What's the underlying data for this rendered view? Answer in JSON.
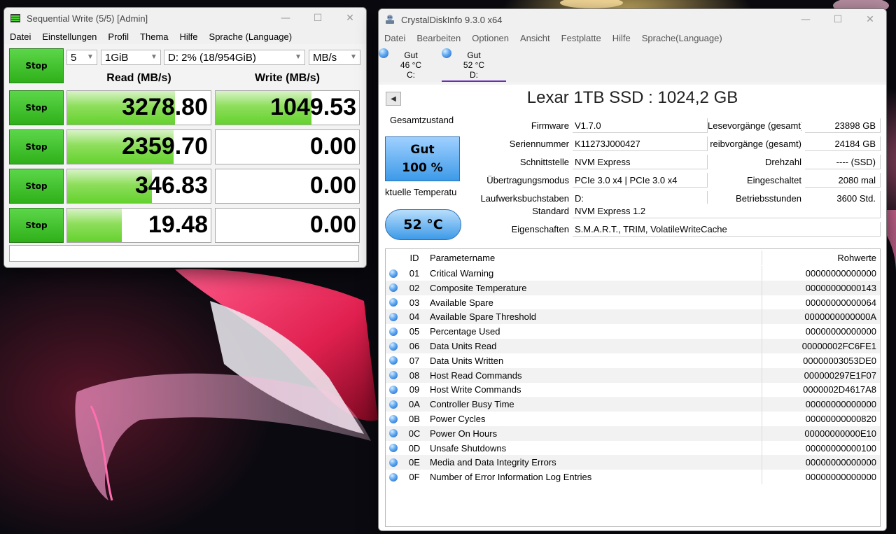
{
  "cdm": {
    "title": "Sequential Write (5/5) [Admin]",
    "menu": [
      "Datei",
      "Einstellungen",
      "Profil",
      "Thema",
      "Hilfe",
      "Sprache (Language)"
    ],
    "stop_label": "Stop",
    "count": "5",
    "size": "1GiB",
    "drive": "D: 2% (18/954GiB)",
    "unit": "MB/s",
    "read_header": "Read (MB/s)",
    "write_header": "Write (MB/s)",
    "rows": [
      {
        "read": "3278.80",
        "write": "1049.53",
        "read_fill": 0.75,
        "write_fill": 0.67
      },
      {
        "read": "2359.70",
        "write": "0.00",
        "read_fill": 0.74,
        "write_fill": 0
      },
      {
        "read": "346.83",
        "write": "0.00",
        "read_fill": 0.59,
        "write_fill": 0
      },
      {
        "read": "19.48",
        "write": "0.00",
        "read_fill": 0.38,
        "write_fill": 0
      }
    ]
  },
  "cdi": {
    "title": "CrystalDiskInfo 9.3.0 x64",
    "menu": [
      "Datei",
      "Bearbeiten",
      "Optionen",
      "Ansicht",
      "Festplatte",
      "Hilfe",
      "Sprache(Language)"
    ],
    "disks": [
      {
        "status": "Gut",
        "temp": "46 °C",
        "letter": "C:"
      },
      {
        "status": "Gut",
        "temp": "52 °C",
        "letter": "D:"
      }
    ],
    "disk_title": "Lexar 1TB SSD : 1024,2 GB",
    "health_label": "Gesamtzustand",
    "health_status": "Gut",
    "health_percent": "100 %",
    "temp_label": "ktuelle Temperatu",
    "temp_value": "52 °C",
    "info_left": [
      {
        "label": "Firmware",
        "value": "V1.7.0"
      },
      {
        "label": "Seriennummer",
        "value": "K11273J000427"
      },
      {
        "label": "Schnittstelle",
        "value": "NVM Express"
      },
      {
        "label": "Übertragungsmodus",
        "value": "PCIe 3.0 x4 | PCIe 3.0 x4"
      },
      {
        "label": "Laufwerksbuchstaben",
        "value": "D:"
      }
    ],
    "info_right": [
      {
        "label": "Lesevorgänge (gesamt)",
        "value": "23898 GB"
      },
      {
        "label": "reibvorgänge (gesamt)",
        "value": "24184 GB"
      },
      {
        "label": "Drehzahl",
        "value": "---- (SSD)"
      },
      {
        "label": "Eingeschaltet",
        "value": "2080 mal"
      },
      {
        "label": "Betriebsstunden",
        "value": "3600 Std."
      }
    ],
    "standard_label": "Standard",
    "standard_value": "NVM Express 1.2",
    "features_label": "Eigenschaften",
    "features_value": "S.M.A.R.T., TRIM, VolatileWriteCache",
    "smart_headers": {
      "id": "ID",
      "name": "Parametername",
      "raw": "Rohwerte"
    },
    "smart": [
      {
        "id": "01",
        "name": "Critical Warning",
        "raw": "00000000000000"
      },
      {
        "id": "02",
        "name": "Composite Temperature",
        "raw": "00000000000143"
      },
      {
        "id": "03",
        "name": "Available Spare",
        "raw": "00000000000064"
      },
      {
        "id": "04",
        "name": "Available Spare Threshold",
        "raw": "0000000000000A"
      },
      {
        "id": "05",
        "name": "Percentage Used",
        "raw": "00000000000000"
      },
      {
        "id": "06",
        "name": "Data Units Read",
        "raw": "00000002FC6FE1"
      },
      {
        "id": "07",
        "name": "Data Units Written",
        "raw": "00000003053DE0"
      },
      {
        "id": "08",
        "name": "Host Read Commands",
        "raw": "000000297E1F07"
      },
      {
        "id": "09",
        "name": "Host Write Commands",
        "raw": "0000002D4617A8"
      },
      {
        "id": "0A",
        "name": "Controller Busy Time",
        "raw": "00000000000000"
      },
      {
        "id": "0B",
        "name": "Power Cycles",
        "raw": "00000000000820"
      },
      {
        "id": "0C",
        "name": "Power On Hours",
        "raw": "00000000000E10"
      },
      {
        "id": "0D",
        "name": "Unsafe Shutdowns",
        "raw": "00000000000100"
      },
      {
        "id": "0E",
        "name": "Media and Data Integrity Errors",
        "raw": "00000000000000"
      },
      {
        "id": "0F",
        "name": "Number of Error Information Log Entries",
        "raw": "00000000000000"
      }
    ]
  }
}
